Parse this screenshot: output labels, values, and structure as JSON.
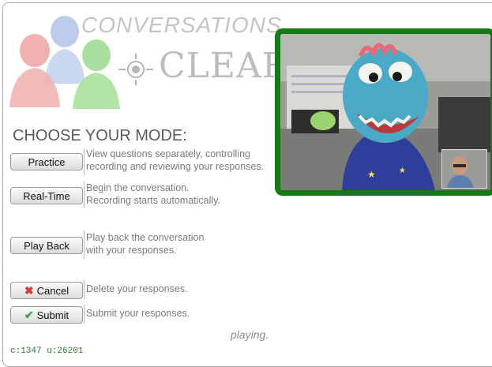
{
  "logo": {
    "title": "CONVERSATIONS",
    "brand": "CLEAR"
  },
  "mode": {
    "heading": "CHOOSE YOUR MODE:"
  },
  "buttons": {
    "practice": {
      "label": "Practice",
      "desc": [
        "View questions separately, controlling",
        "recording and reviewing your responses."
      ]
    },
    "realtime": {
      "label": "Real-Time",
      "desc": [
        "Begin the conversation.",
        "Recording starts automatically."
      ]
    },
    "playback": {
      "label": "Play Back",
      "desc": [
        "Play back the conversation",
        "with your responses."
      ]
    },
    "cancel": {
      "label": "Cancel",
      "icon": "x-icon",
      "desc": [
        "Delete your responses."
      ]
    },
    "submit": {
      "label": "Submit",
      "icon": "check-icon",
      "desc": [
        "Submit your responses."
      ]
    }
  },
  "status": {
    "text": "playing."
  },
  "counter": {
    "text": "c:1347 u:26201"
  },
  "video": {
    "border_color": "#157a15"
  }
}
